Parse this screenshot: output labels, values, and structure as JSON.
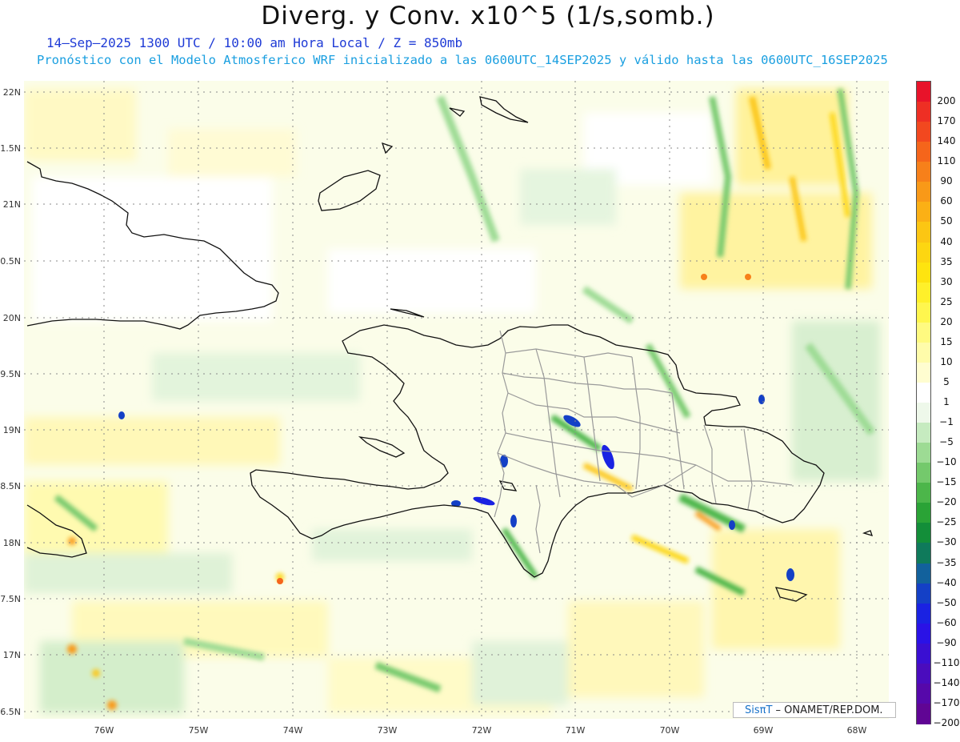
{
  "title": "Diverg. y Conv. x10^5 (1/s,somb.)",
  "subtitle1": "14–Sep–2025  1300 UTC / 10:00 am Hora Local / Z = 850mb",
  "subtitle2": "Pronóstico con el Modelo Atmosferico WRF inicializado a las 0600UTC_14SEP2025 y válido hasta las  0600UTC_16SEP2025",
  "credit": {
    "logo": "SisπΤ",
    "text": " – ONAMET/REP.DOM."
  },
  "lat_labels": [
    "22N",
    "1.5N",
    "21N",
    "0.5N",
    "20N",
    "9.5N",
    "19N",
    "8.5N",
    "18N",
    "7.5N",
    "17N",
    "6.5N"
  ],
  "lon_labels": [
    "76W",
    "75W",
    "74W",
    "73W",
    "72W",
    "71W",
    "70W",
    "69W",
    "68W"
  ],
  "colorbar": [
    {
      "label": "200",
      "color": "#e8132a"
    },
    {
      "label": "170",
      "color": "#ee2f24"
    },
    {
      "label": "140",
      "color": "#f2481f"
    },
    {
      "label": "110",
      "color": "#f5651b"
    },
    {
      "label": "90",
      "color": "#f7801a"
    },
    {
      "label": "60",
      "color": "#f99918"
    },
    {
      "label": "50",
      "color": "#fbb015"
    },
    {
      "label": "40",
      "color": "#fcc613"
    },
    {
      "label": "35",
      "color": "#fdd611"
    },
    {
      "label": "30",
      "color": "#fee40f"
    },
    {
      "label": "25",
      "color": "#fff02a"
    },
    {
      "label": "20",
      "color": "#fff64e"
    },
    {
      "label": "15",
      "color": "#fffa80"
    },
    {
      "label": "10",
      "color": "#fffcaa"
    },
    {
      "label": "5",
      "color": "#fffdd0"
    },
    {
      "label": "1",
      "color": "#ffffff"
    },
    {
      "label": "−1",
      "color": "#eef8ea"
    },
    {
      "label": "−5",
      "color": "#c6ebc0"
    },
    {
      "label": "−10",
      "color": "#9ddb94"
    },
    {
      "label": "−15",
      "color": "#74c96c"
    },
    {
      "label": "−20",
      "color": "#4cb64a"
    },
    {
      "label": "−25",
      "color": "#2aa336"
    },
    {
      "label": "−30",
      "color": "#138e39"
    },
    {
      "label": "−35",
      "color": "#0f7a5b"
    },
    {
      "label": "−40",
      "color": "#12619c"
    },
    {
      "label": "−50",
      "color": "#1440c6"
    },
    {
      "label": "−60",
      "color": "#1a22e2"
    },
    {
      "label": "−90",
      "color": "#2a12e6"
    },
    {
      "label": "−110",
      "color": "#3a0fd2"
    },
    {
      "label": "−140",
      "color": "#4a0cbd"
    },
    {
      "label": "−170",
      "color": "#5608aa"
    },
    {
      "label": "−200",
      "color": "#600594"
    }
  ]
}
